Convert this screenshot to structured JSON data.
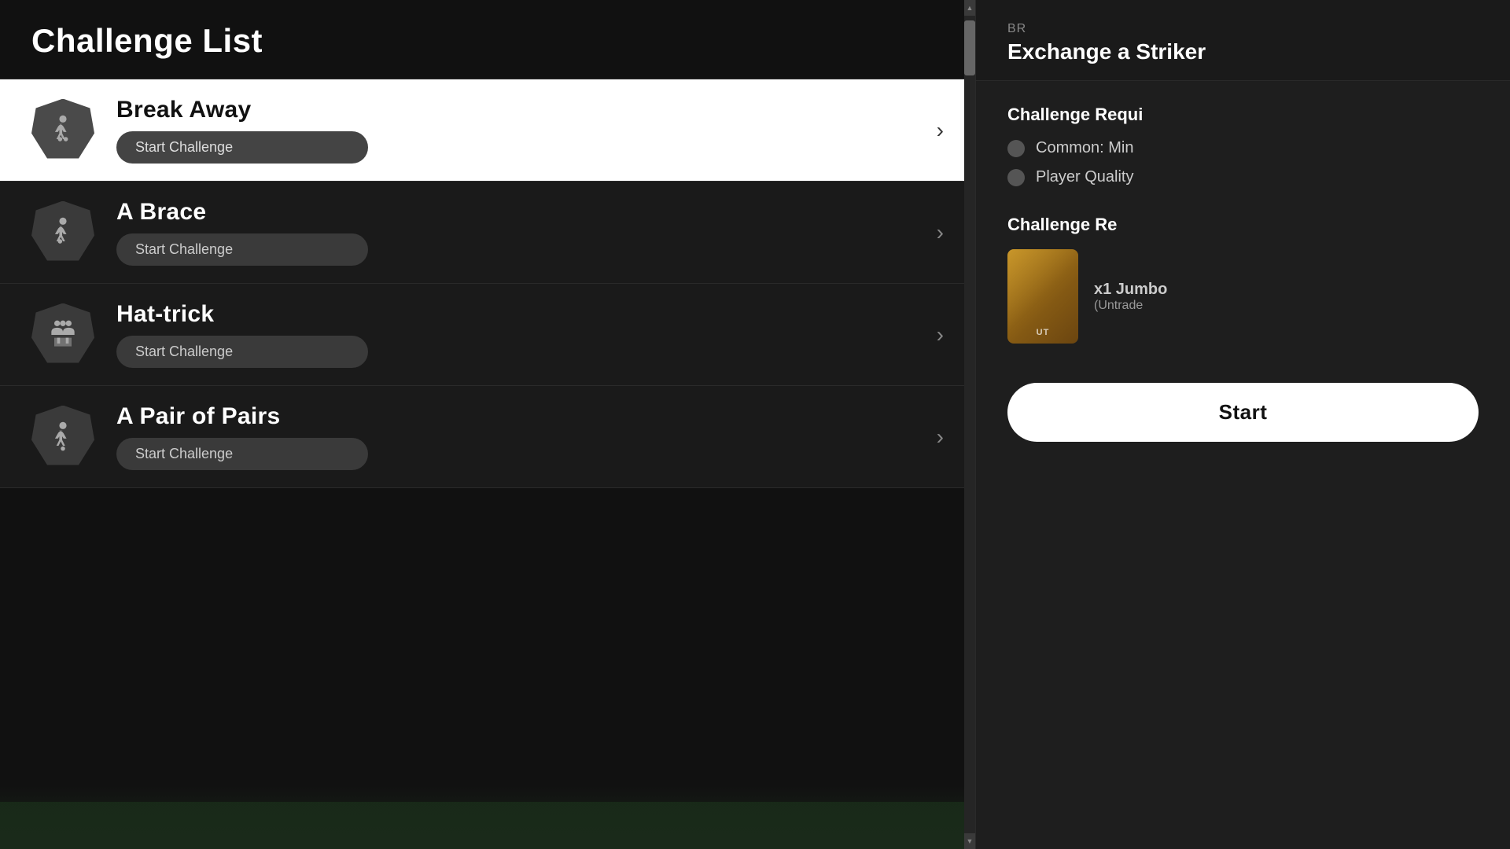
{
  "challengeList": {
    "title": "Challenge List",
    "challenges": [
      {
        "id": "break-away",
        "name": "Break Away",
        "btnLabel": "Start Challenge",
        "iconType": "striker",
        "active": true
      },
      {
        "id": "a-brace",
        "name": "A Brace",
        "btnLabel": "Start Challenge",
        "iconType": "striker",
        "active": false
      },
      {
        "id": "hat-trick",
        "name": "Hat-trick",
        "btnLabel": "Start Challenge",
        "iconType": "team",
        "active": false
      },
      {
        "id": "pair-of-pairs",
        "name": "A Pair of Pairs",
        "btnLabel": "Start Challenge",
        "iconType": "striker",
        "active": false
      }
    ]
  },
  "details": {
    "breadcrumb": "Br",
    "subtitle": "Exchange a Striker",
    "requirementsLabel": "Challenge Requi",
    "requirements": [
      {
        "label": "Common: Min"
      },
      {
        "label": "Player Quality"
      }
    ],
    "rewardsLabel": "Challenge Re",
    "reward": {
      "cardLabel": "UT",
      "rewardText": "x1 Jumbo",
      "rewardSub": "(Untrade"
    },
    "startLabel": "Start"
  }
}
